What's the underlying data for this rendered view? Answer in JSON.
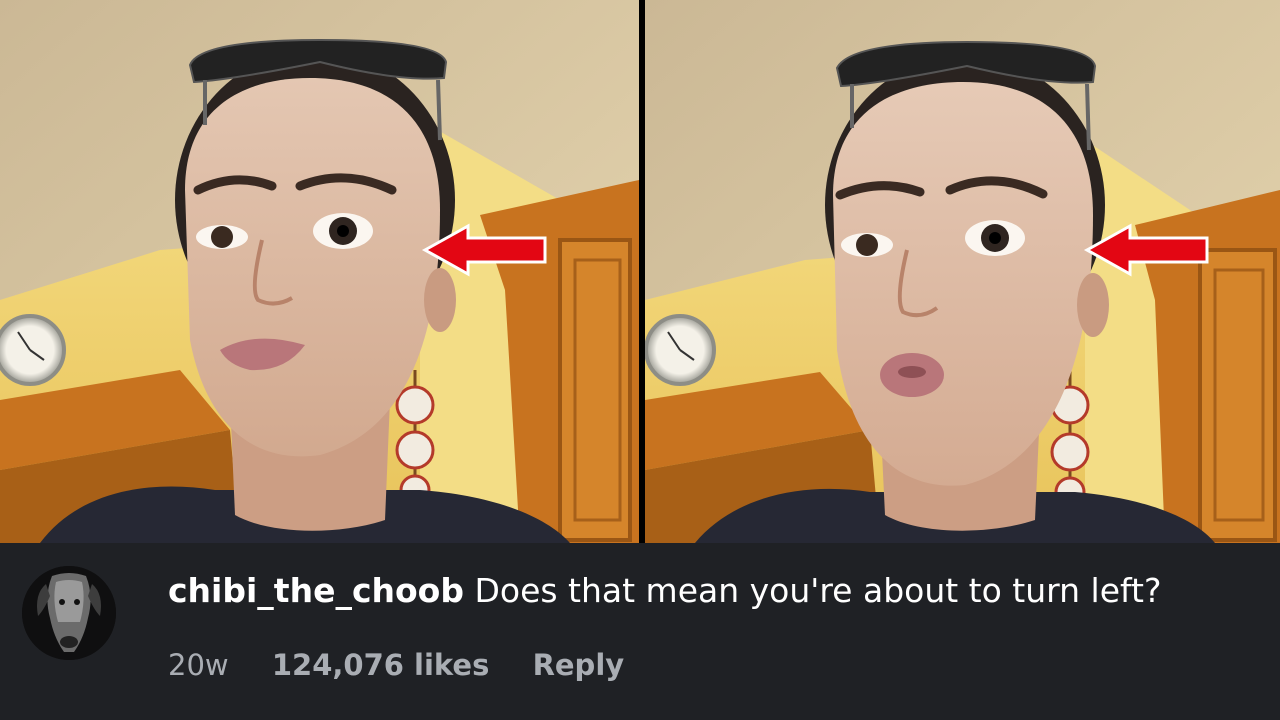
{
  "video": {
    "frames": [
      {
        "name": "left-frame"
      },
      {
        "name": "right-frame"
      }
    ],
    "arrow_color": "#e30613",
    "arrow_outline": "#ffffff"
  },
  "comment": {
    "username": "chibi_the_choob",
    "text": "Does that mean you're about to turn left?",
    "age": "20w",
    "likes": "124,076 likes",
    "reply_label": "Reply",
    "avatar_icon": "dog-avatar-icon"
  },
  "colors": {
    "bar_background": "#1f2125",
    "primary_text": "#ffffff",
    "secondary_text": "#a9adb3"
  }
}
